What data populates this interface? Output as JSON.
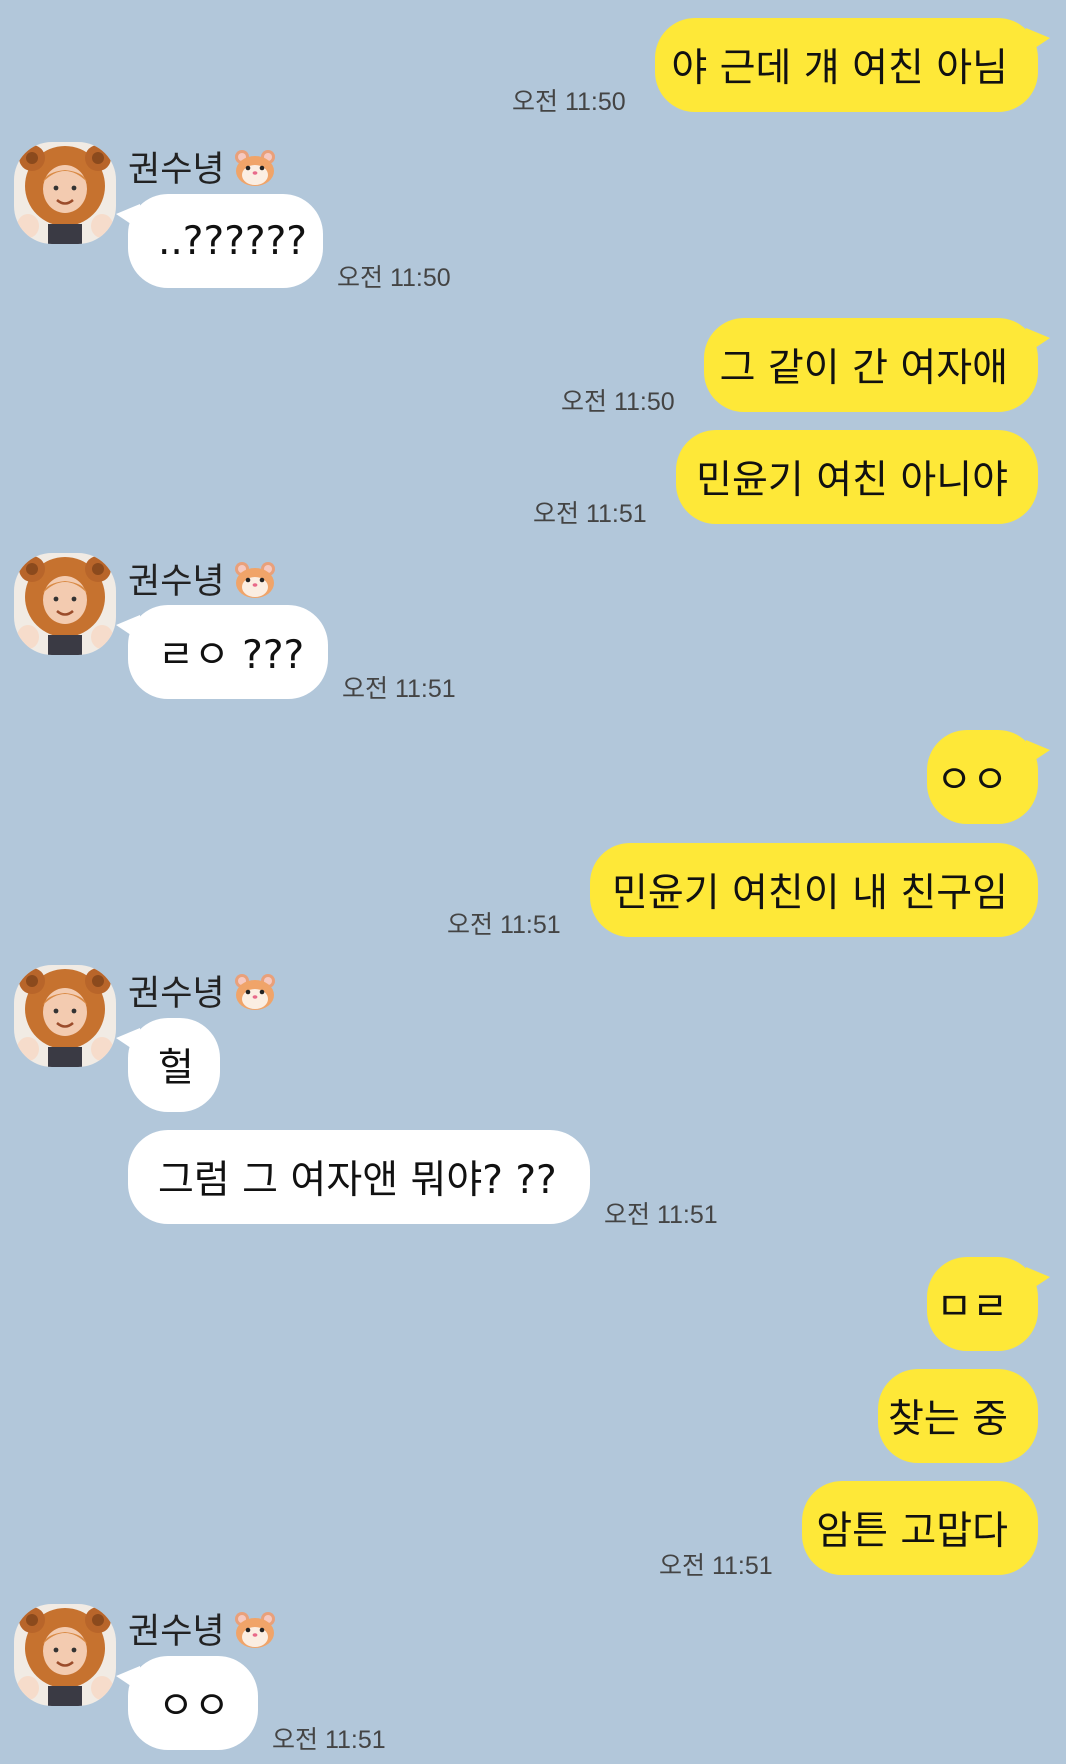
{
  "contact": {
    "name": "권수녕",
    "name_icon": "hamster-emoji-icon",
    "avatar_icon": "lion-costume-avatar"
  },
  "messages": [
    {
      "side": "outgoing",
      "text": "야 근데 걔 여친 아님",
      "time": "오전 11:50"
    },
    {
      "side": "incoming",
      "text": "..??????",
      "time": "오전 11:50"
    },
    {
      "side": "outgoing",
      "text": "그 같이 간 여자애",
      "time": "오전 11:50"
    },
    {
      "side": "outgoing",
      "text": "민윤기 여친 아니야",
      "time": "오전 11:51"
    },
    {
      "side": "incoming",
      "text": "ㄹㅇ ???",
      "time": "오전 11:51"
    },
    {
      "side": "outgoing",
      "text": "ㅇㅇ",
      "time": ""
    },
    {
      "side": "outgoing",
      "text": "민윤기 여친이 내 친구임",
      "time": "오전 11:51"
    },
    {
      "side": "incoming",
      "text": "헐",
      "time": ""
    },
    {
      "side": "incoming",
      "text": "그럼 그 여자앤 뭐야? ??",
      "time": "오전 11:51"
    },
    {
      "side": "outgoing",
      "text": "ㅁㄹ",
      "time": ""
    },
    {
      "side": "outgoing",
      "text": "찾는 중",
      "time": ""
    },
    {
      "side": "outgoing",
      "text": "암튼 고맙다",
      "time": "오전 11:51"
    },
    {
      "side": "incoming",
      "text": "ㅇㅇ",
      "time": "오전 11:51"
    }
  ],
  "colors": {
    "background": "#b2c7da",
    "outgoing_bubble": "#fee838",
    "incoming_bubble": "#ffffff",
    "timestamp": "#444444"
  }
}
